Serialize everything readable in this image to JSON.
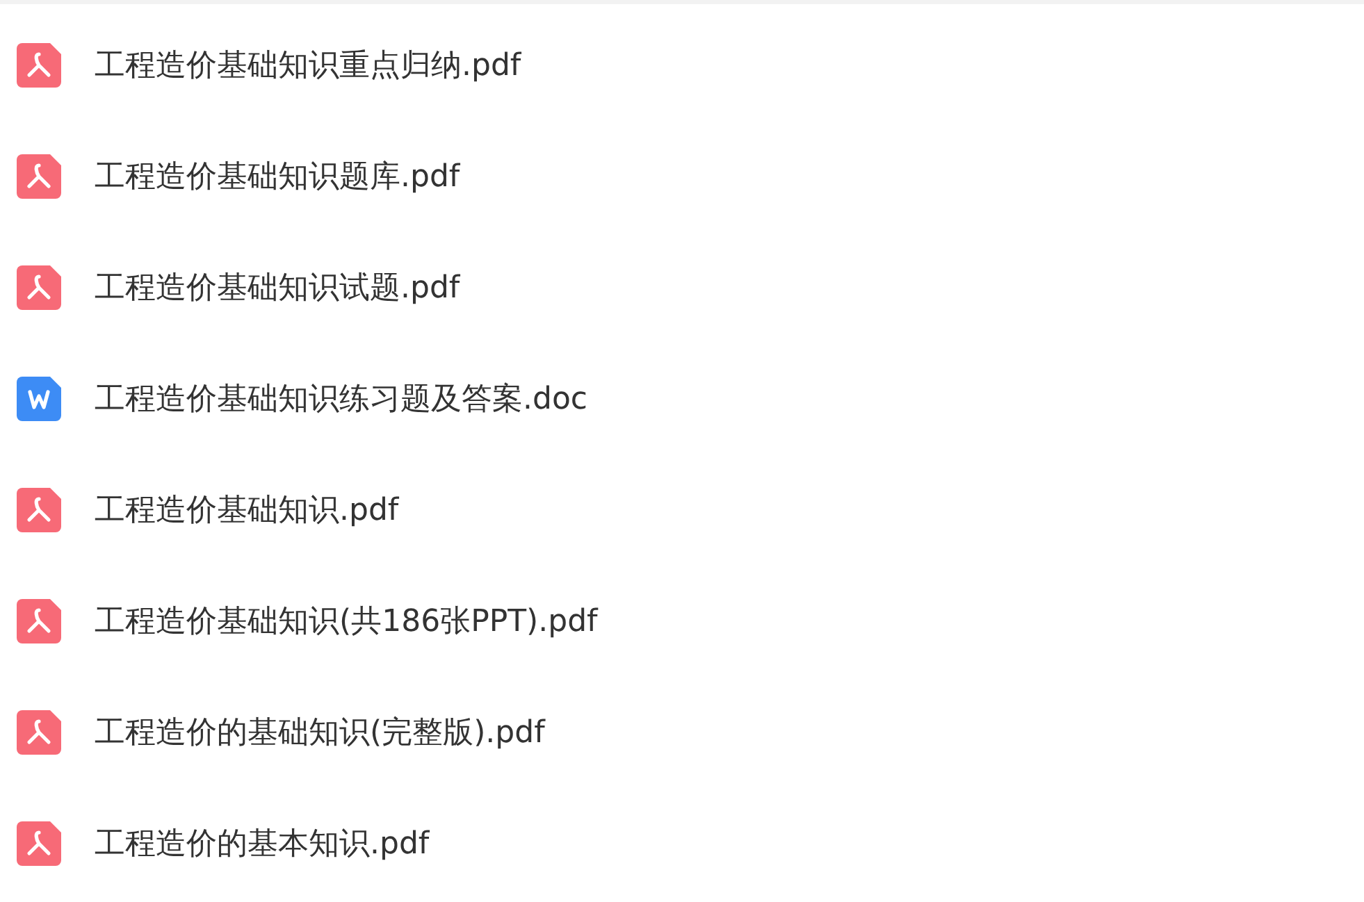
{
  "files": [
    {
      "name": "工程造价基础知识重点归纳.pdf",
      "kind": "pdf"
    },
    {
      "name": "工程造价基础知识题库.pdf",
      "kind": "pdf"
    },
    {
      "name": "工程造价基础知识试题.pdf",
      "kind": "pdf"
    },
    {
      "name": "工程造价基础知识练习题及答案.doc",
      "kind": "doc"
    },
    {
      "name": "工程造价基础知识.pdf",
      "kind": "pdf"
    },
    {
      "name": "工程造价基础知识(共186张PPT).pdf",
      "kind": "pdf"
    },
    {
      "name": "工程造价的基础知识(完整版).pdf",
      "kind": "pdf"
    },
    {
      "name": "工程造价的基本知识.pdf",
      "kind": "pdf"
    }
  ]
}
